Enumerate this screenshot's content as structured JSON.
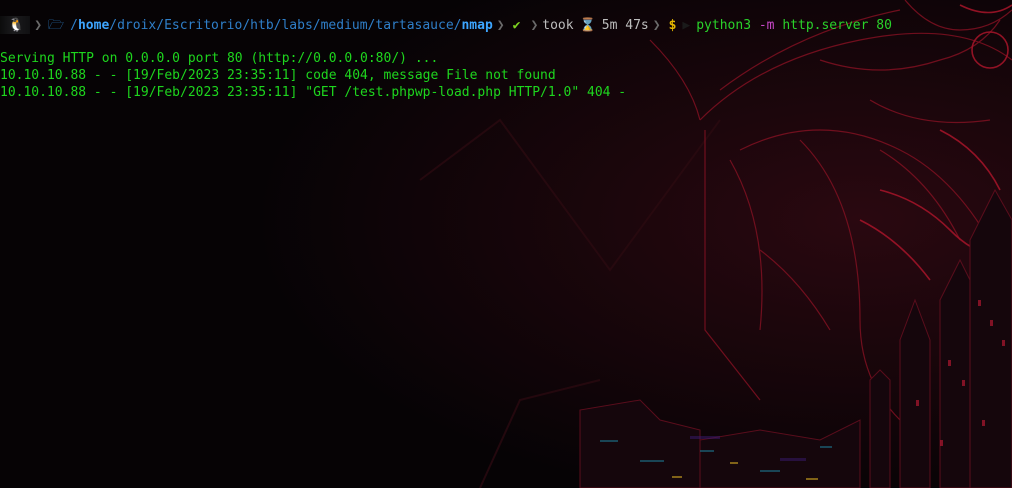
{
  "colors": {
    "output_green": "#1ed61e",
    "path_blue": "#2f7fc9",
    "path_bold_blue": "#3da6ff",
    "check_green": "#7ed321",
    "dollar_yellow": "#e6b800",
    "flag_magenta": "#c848c8",
    "background": "#060305",
    "art_red": "#ff2a3a"
  },
  "prompt": {
    "os_icon": "linux-icon",
    "folder_icon": "folder-icon",
    "path_prefix": "/",
    "path_home": "home",
    "path_middle": "/droix/Escritorio/htb/labs/medium/tartasauce/",
    "path_current": "nmap",
    "status_icon": "✔",
    "took_label": "took",
    "hourglass_icon": "⌛",
    "duration": "5m 47s",
    "dollar": "$",
    "command": "python3",
    "flag": "-m",
    "args": "http.server 80"
  },
  "output": {
    "line1": "Serving HTTP on 0.0.0.0 port 80 (http://0.0.0.0:80/) ...",
    "line2": "10.10.10.88 - - [19/Feb/2023 23:35:11] code 404, message File not found",
    "line3": "10.10.10.88 - - [19/Feb/2023 23:35:11] \"GET /test.phpwp-load.php HTTP/1.0\" 404 -"
  }
}
